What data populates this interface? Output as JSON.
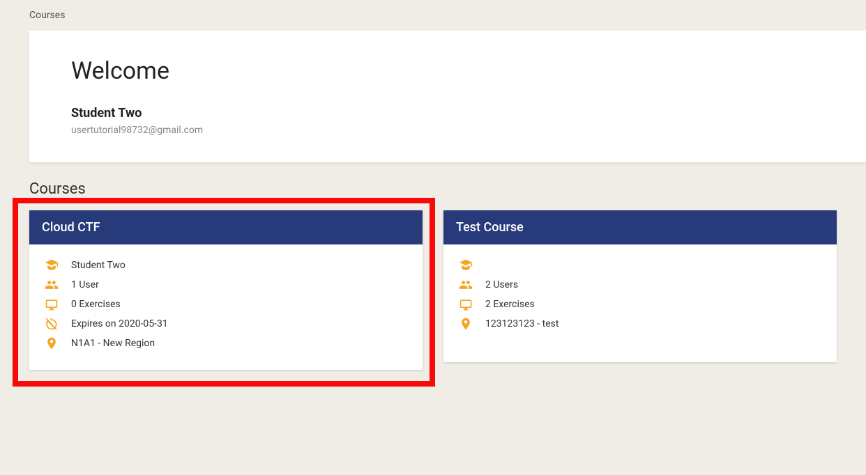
{
  "breadcrumb": "Courses",
  "welcome": {
    "title": "Welcome",
    "user_name": "Student Two",
    "user_email": "usertutorial98732@gmail.com"
  },
  "section": {
    "title": "Courses"
  },
  "courses": [
    {
      "title": "Cloud CTF",
      "highlighted": true,
      "lines": [
        {
          "icon": "graduation-cap-icon",
          "text": "Student Two"
        },
        {
          "icon": "users-icon",
          "text": "1 User"
        },
        {
          "icon": "monitor-icon",
          "text": "0 Exercises"
        },
        {
          "icon": "alarm-off-icon",
          "text": "Expires on 2020-05-31"
        },
        {
          "icon": "location-pin-icon",
          "text": "N1A1 - New Region"
        }
      ]
    },
    {
      "title": "Test Course",
      "highlighted": false,
      "lines": [
        {
          "icon": "graduation-cap-icon",
          "text": ""
        },
        {
          "icon": "users-icon",
          "text": "2 Users"
        },
        {
          "icon": "monitor-icon",
          "text": "2 Exercises"
        },
        {
          "icon": "location-pin-icon",
          "text": "123123123 - test"
        }
      ]
    }
  ]
}
